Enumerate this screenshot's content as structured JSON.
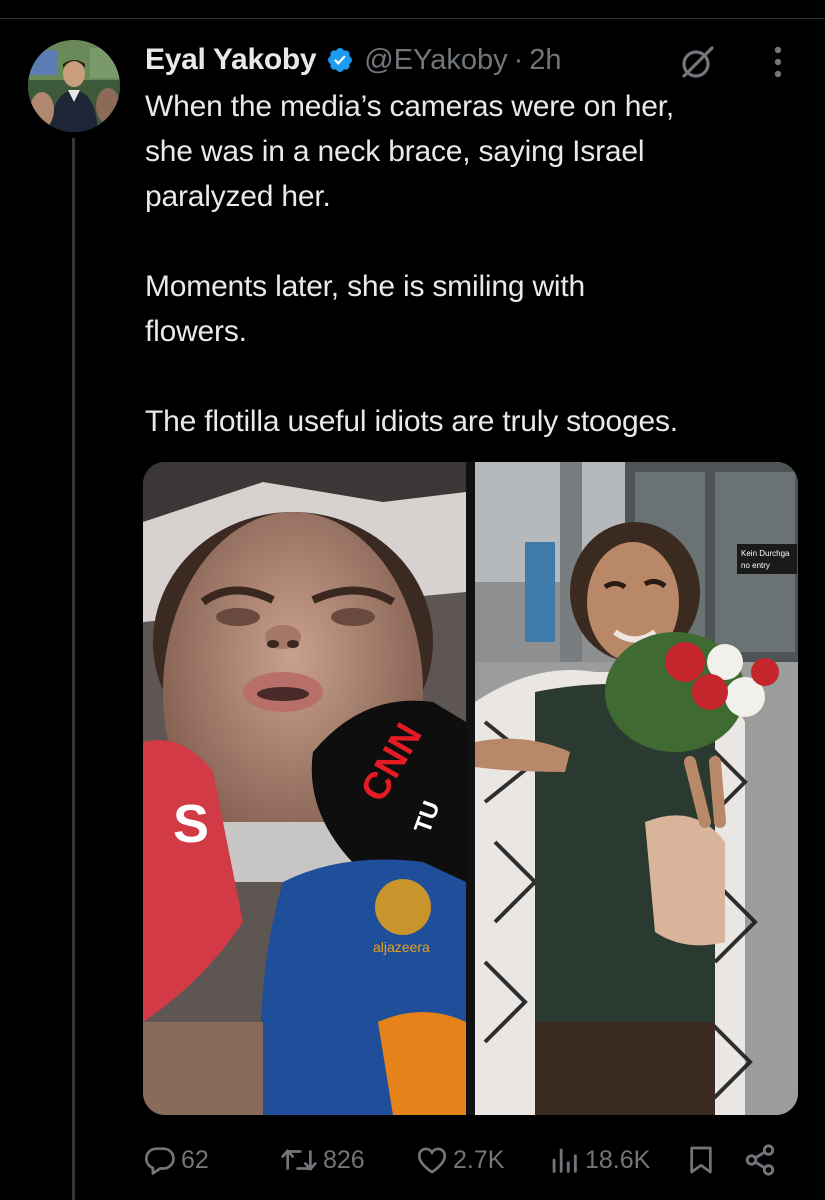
{
  "author": {
    "name": "Eyal Yakoby",
    "handle": "@EYakoby",
    "separator": "·",
    "time": "2h",
    "verified": true
  },
  "tweet": {
    "text": "When the media’s cameras were on her,\nshe was in a neck brace, saying Israel\nparalyzed her.\n\nMoments later, she is smiling with\nflowers.\n\nThe flotilla useful idiots are truly stooges."
  },
  "media": {
    "left_image": {
      "mic_text_cnn": "CNN",
      "mic_text_tu": "TU",
      "mic_text_aljazeera": "aljazeera"
    },
    "right_image": {
      "sign_line1": "Kein Durchga",
      "sign_line2": "no entry"
    }
  },
  "actions": {
    "replies": "62",
    "reposts": "826",
    "likes": "2.7K",
    "views": "18.6K"
  },
  "colors": {
    "background": "#000000",
    "text": "#e7e9ea",
    "muted": "#71767b",
    "verified": "#1d9bf0",
    "divider": "#2f3336"
  },
  "icons": {
    "verified": "verified-badge-icon",
    "grok": "grok-icon",
    "more": "more-icon",
    "reply": "reply-icon",
    "repost": "repost-icon",
    "like": "heart-icon",
    "views": "views-icon",
    "bookmark": "bookmark-icon",
    "share": "share-icon"
  }
}
